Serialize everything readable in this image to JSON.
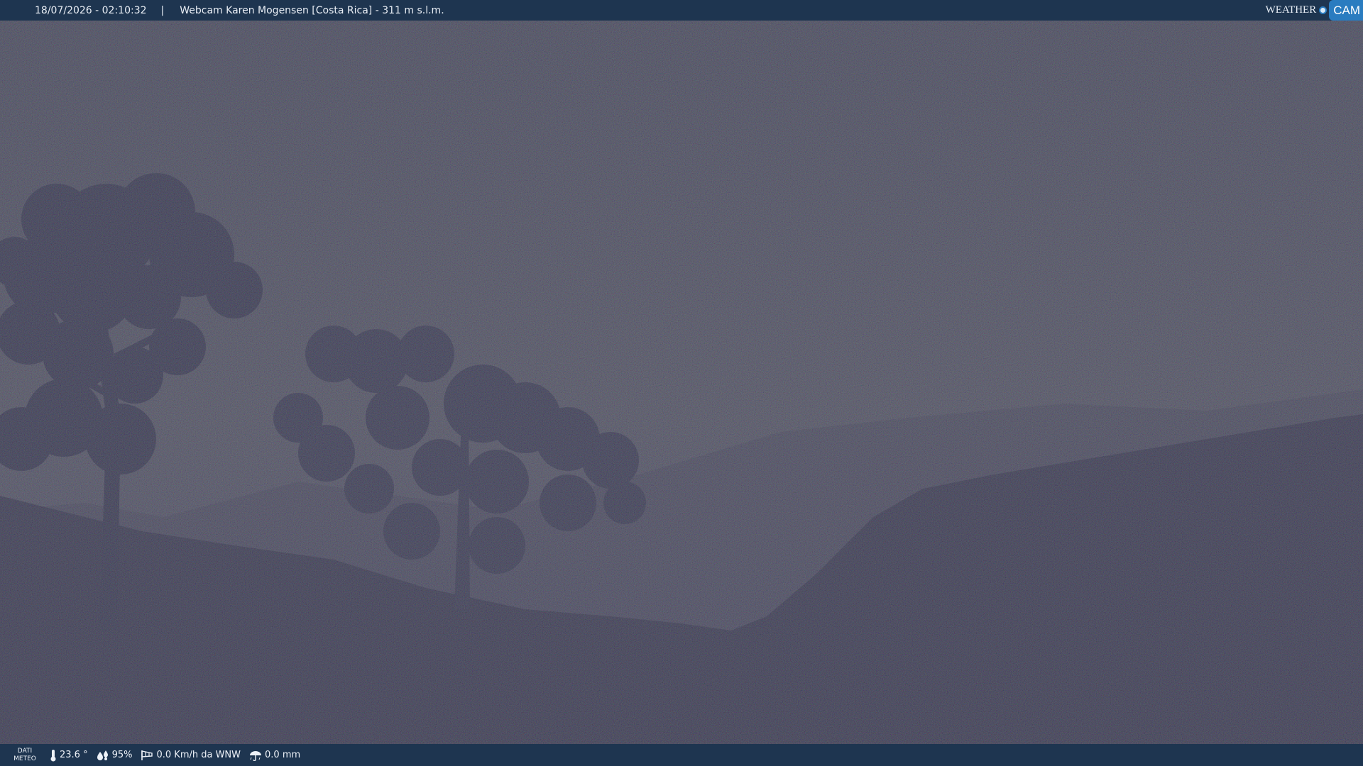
{
  "header": {
    "datetime": "18/07/2026 - 02:10:32",
    "separator": "|",
    "title": "Webcam Karen Mogensen [Costa Rica]  - 311 m s.l.m."
  },
  "logo": {
    "word1": "WEATHER",
    "word2": "CAM"
  },
  "weather": {
    "label_line1": "DATI",
    "label_line2": "METEO",
    "temperature": "23.6 °",
    "humidity": "95%",
    "wind": "0.0 Km/h da WNW",
    "rain": "0.0 mm"
  },
  "icons": {
    "temperature": "thermometer-icon",
    "humidity": "humidity-drops-icon",
    "wind": "wind-sock-icon",
    "rain": "rain-umbrella-icon"
  },
  "colors": {
    "bar_background": "#1e3550",
    "sky": "#4a4b5a",
    "ground": "#2b2c3f",
    "logo_accent": "#2a7cc0"
  }
}
